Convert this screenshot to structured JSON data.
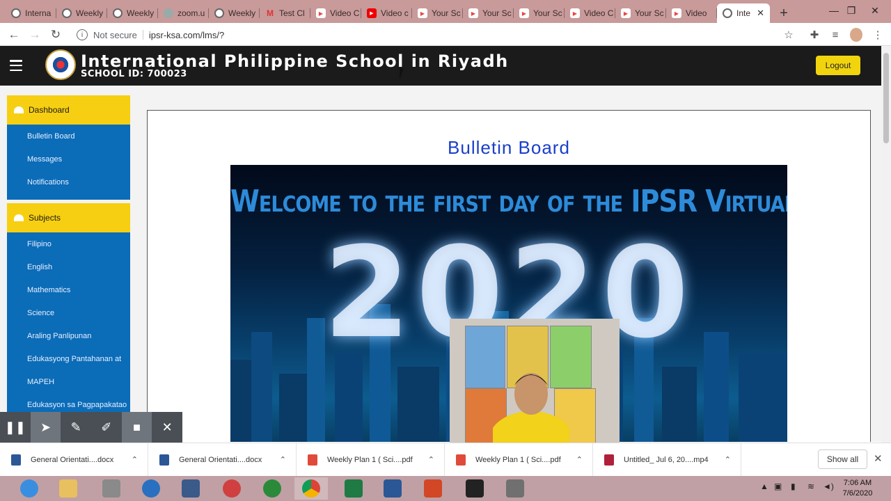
{
  "browser": {
    "tabs": [
      {
        "title": "Interna",
        "icon": "globe-icon"
      },
      {
        "title": "Weekly",
        "icon": "globe-icon"
      },
      {
        "title": "Weekly",
        "icon": "globe-icon"
      },
      {
        "title": "zoom.u",
        "icon": "zoom-icon"
      },
      {
        "title": "Weekly",
        "icon": "globe-icon"
      },
      {
        "title": "Test Cl",
        "icon": "gmail-icon"
      },
      {
        "title": "Video C",
        "icon": "video-icon"
      },
      {
        "title": "Video c",
        "icon": "youtube-icon"
      },
      {
        "title": "Your Sc",
        "icon": "video-icon"
      },
      {
        "title": "Your Sc",
        "icon": "video-icon"
      },
      {
        "title": "Your Sc",
        "icon": "video-icon"
      },
      {
        "title": "Video C",
        "icon": "video-icon"
      },
      {
        "title": "Your Sc",
        "icon": "video-icon"
      },
      {
        "title": "Video",
        "icon": "video-icon"
      },
      {
        "title": "Inte",
        "icon": "globe-icon",
        "active": true
      }
    ],
    "security_label": "Not secure",
    "url": "ipsr-ksa.com/lms/?"
  },
  "site": {
    "school_name": "International Philippine School in Riyadh",
    "school_id": "SCHOOL ID: 700023",
    "logout_label": "Logout"
  },
  "sidebar": {
    "group1": {
      "heading": "Dashboard",
      "items": [
        "Bulletin Board",
        "Messages",
        "Notifications"
      ]
    },
    "group2": {
      "heading": "Subjects",
      "items": [
        "Filipino",
        "English",
        "Mathematics",
        "Science",
        "Araling Panlipunan",
        "Edukasyong Pantahanan at",
        "MAPEH",
        "Edukasyon sa Pagpapakatao"
      ]
    }
  },
  "content": {
    "title": "Bulletin Board",
    "banner_headline": "Welcome to the first day of the IPSR Virtual Class",
    "banner_year": "2020"
  },
  "downloads": {
    "items": [
      {
        "name": "General Orientati....docx",
        "type": "docx"
      },
      {
        "name": "General Orientati....docx",
        "type": "docx"
      },
      {
        "name": "Weekly Plan 1 ( Sci....pdf",
        "type": "pdf"
      },
      {
        "name": "Weekly Plan 1 ( Sci....pdf",
        "type": "pdf"
      },
      {
        "name": "Untitled_ Jul 6, 20....mp4",
        "type": "mp4"
      }
    ],
    "show_all_label": "Show all"
  },
  "taskbar": {
    "time": "7:06 AM",
    "date": "7/6/2020"
  },
  "colors": {
    "accent_yellow": "#f7cf12",
    "sidebar_blue": "#0b6cb8",
    "header_dark": "#1b1b1b",
    "title_blue": "#1a3fc8"
  }
}
